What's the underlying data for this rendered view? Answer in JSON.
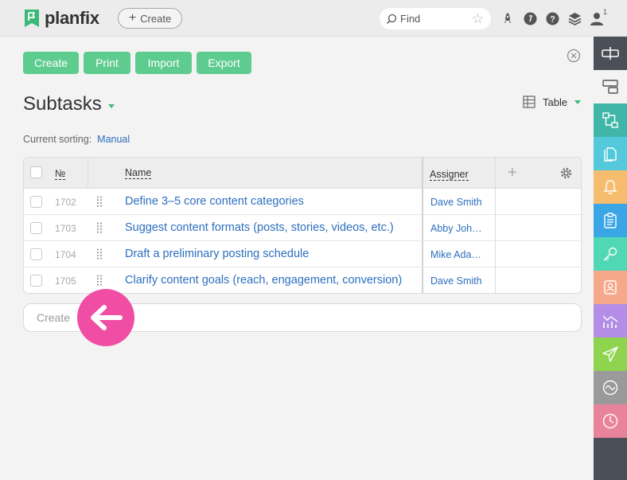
{
  "app": {
    "name": "planfix"
  },
  "topbar": {
    "create_label": "Create",
    "search_placeholder": "Find",
    "user_badge": "1"
  },
  "actions": {
    "create": "Create",
    "print": "Print",
    "import": "Import",
    "export": "Export"
  },
  "page": {
    "title": "Subtasks",
    "view": "Table"
  },
  "sorting": {
    "label": "Current sorting:",
    "value": "Manual"
  },
  "table": {
    "headers": {
      "number": "№",
      "name": "Name",
      "assigner": "Assigner"
    },
    "rows": [
      {
        "number": "1702",
        "name": "Define 3–5 core content categories",
        "assigner": "Dave Smith"
      },
      {
        "number": "1703",
        "name": "Suggest content formats (posts, stories, videos, etc.)",
        "assigner": "Abby Joh…"
      },
      {
        "number": "1704",
        "name": "Draft a preliminary posting schedule",
        "assigner": "Mike Ada…"
      },
      {
        "number": "1705",
        "name": "Clarify content goals (reach, engagement, conversion)",
        "assigner": "Dave Smith"
      }
    ]
  },
  "create_row": {
    "placeholder": "Create"
  },
  "colors": {
    "accent_green": "#5ecc8f",
    "link_blue": "#2c6fbf",
    "pointer_pink": "#f04ea4",
    "sidebar_dark": "#4b4f57"
  },
  "sidebar": {
    "items": [
      {
        "icon": "panel-toggle-icon",
        "color": "#4b4f57"
      },
      {
        "icon": "layout-icon",
        "color": "#f3f3f3"
      },
      {
        "icon": "process-icon",
        "color": "#3fb6a8"
      },
      {
        "icon": "documents-icon",
        "color": "#54c9dc"
      },
      {
        "icon": "bell-icon",
        "color": "#f6bd6e"
      },
      {
        "icon": "clipboard-icon",
        "color": "#3aa6e6"
      },
      {
        "icon": "key-icon",
        "color": "#4fd8b3"
      },
      {
        "icon": "contact-icon",
        "color": "#f5a98a"
      },
      {
        "icon": "analytics-icon",
        "color": "#b48ee6"
      },
      {
        "icon": "send-icon",
        "color": "#8fd44f"
      },
      {
        "icon": "activity-icon",
        "color": "#9a9a9a"
      },
      {
        "icon": "clock-icon",
        "color": "#e8839b"
      }
    ]
  }
}
